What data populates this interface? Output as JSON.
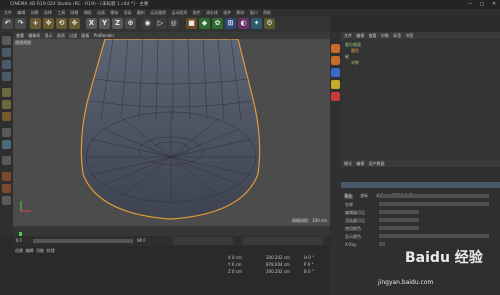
{
  "window": {
    "title": "CINEMA 4D R19.024 Studio (RC - R19) - [未标题 1.c4d *] - 主要",
    "controls": [
      "—",
      "□",
      "✕"
    ]
  },
  "menu": {
    "items": [
      "文件",
      "编辑",
      "创建",
      "选择",
      "工具",
      "网格",
      "捕捉",
      "动画",
      "模拟",
      "渲染",
      "雕刻",
      "运动跟踪",
      "运动图形",
      "角色",
      "流水线",
      "插件",
      "脚本",
      "窗口",
      "帮助"
    ]
  },
  "toolbar": {
    "buttons": [
      "↶",
      "↷",
      "+",
      "✥",
      "⟲",
      "✥",
      "X",
      "Y",
      "Z",
      "⊕",
      "◉",
      "▷",
      "◎",
      "■",
      "◆",
      "✿",
      "⊞",
      "◐",
      "✦",
      "⚙"
    ]
  },
  "viewport": {
    "header_items": [
      "查看",
      "摄像机",
      "显示",
      "选项",
      "过滤",
      "面板",
      "ProRender"
    ],
    "label": "透视视图",
    "scale_text": "网格间距：100 cm"
  },
  "objects": {
    "header_items": [
      "文件",
      "编辑",
      "查看",
      "对象",
      "标签",
      "书签"
    ],
    "rows": [
      "细分曲面",
      "圆柱",
      "碗",
      "对称"
    ]
  },
  "attributes": {
    "tabs": [
      "模式",
      "编辑",
      "用户数据"
    ],
    "rows": [
      "基本",
      "坐标",
      "对象",
      "平滑着色(Phong)"
    ],
    "fields": [
      "图层",
      "名称",
      "编辑器可见",
      "渲染器可见",
      "使用颜色",
      "显示颜色",
      "X-Ray"
    ]
  },
  "coords": {
    "rows": [
      "X 0 cm",
      "Y 0 cm",
      "Z 0 cm"
    ],
    "values": [
      "200.202 cm",
      "878.004 cm",
      "200.202 cm"
    ],
    "angles": [
      "H 0 °",
      "P 0 °",
      "B 0 °"
    ]
  },
  "timeline": {
    "start": "0 F",
    "end": "90 F",
    "ticks": [
      "0",
      "5",
      "10",
      "15",
      "20",
      "25",
      "30",
      "35",
      "40",
      "45",
      "50",
      "55",
      "60",
      "65",
      "70",
      "75",
      "80",
      "85",
      "90"
    ]
  },
  "materials": {
    "tabs": [
      "创建",
      "编辑",
      "功能",
      "纹理"
    ]
  },
  "watermark": {
    "brand": "Baidu 经验",
    "url": "jingyan.baidu.com"
  }
}
